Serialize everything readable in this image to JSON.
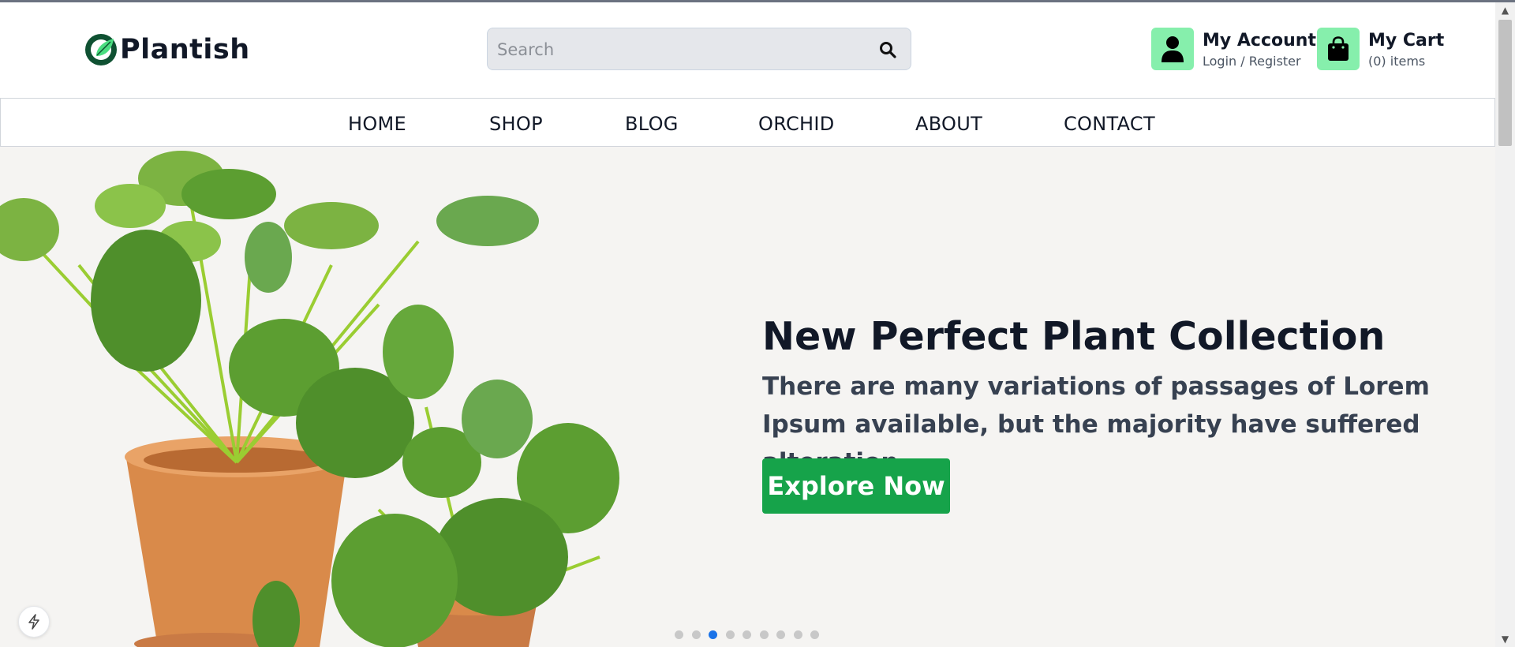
{
  "brand": {
    "name": "Plantish",
    "logo_icon": "leaf-logo-icon",
    "color": "#0f5132"
  },
  "search": {
    "placeholder": "Search",
    "value": "",
    "icon": "search-icon"
  },
  "account": {
    "title": "My Account",
    "subtitle": "Login / Register",
    "icon": "user-icon"
  },
  "cart": {
    "title": "My Cart",
    "subtitle": "(0) items",
    "icon": "shopping-bag-icon"
  },
  "nav": [
    {
      "label": "HOME"
    },
    {
      "label": "SHOP"
    },
    {
      "label": "BLOG"
    },
    {
      "label": "ORCHID"
    },
    {
      "label": "ABOUT"
    },
    {
      "label": "CONTACT"
    }
  ],
  "hero": {
    "title": "New Perfect Plant Collection",
    "description": "There are many variations of passages of Lorem Ipsum available, but the majority have suffered alteration...",
    "button": "Explore Now",
    "slide_count": 9,
    "active_slide": 3
  },
  "colors": {
    "accent": "#16a34a",
    "icon_box": "#86efac",
    "active_dot": "#1a73e8",
    "hero_bg": "#f5f4f2"
  }
}
